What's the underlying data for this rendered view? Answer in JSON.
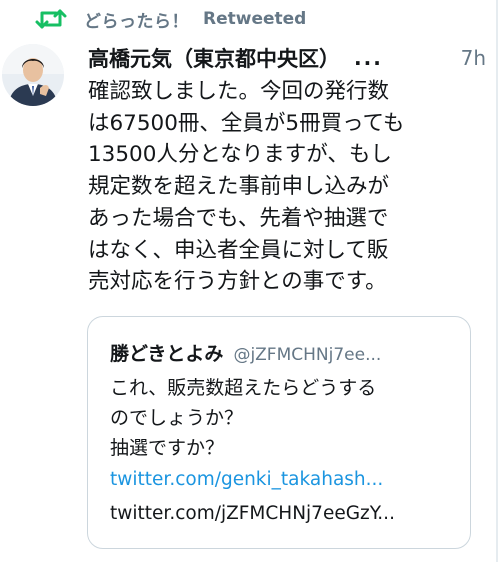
{
  "retweet": {
    "retweeter_name": "どらったら！",
    "label": "Retweeted",
    "icon": "retweet-icon",
    "icon_color": "#17bf63"
  },
  "tweet": {
    "author_name": "高橋元気（東京都中央区）",
    "ellipsis": "...",
    "timestamp": "7h",
    "text_lines": [
      "確認致しました。今回の発行数",
      "は67500冊、全員が5冊買っても",
      "13500人分となりますが、もし",
      "規定数を超えた事前申し込みが",
      "あった場合でも、先着や抽選で",
      "はなく、申込者全員に対して販",
      "売対応を行う方針との事です。"
    ]
  },
  "quote": {
    "author_name": "勝どきとよみ",
    "handle": "@jZFMCHNj7ee...",
    "body_lines": [
      "これ、販売数超えたらどうする",
      "のでしょうか？",
      "抽選ですか？"
    ],
    "link_1": "twitter.com/genki_takahash...",
    "link_2": "twitter.com/jZFMCHNj7eeGzY..."
  },
  "colors": {
    "text_primary": "#14171a",
    "text_secondary": "#657786",
    "link": "#1b95e0",
    "border": "#ccd6dd"
  }
}
